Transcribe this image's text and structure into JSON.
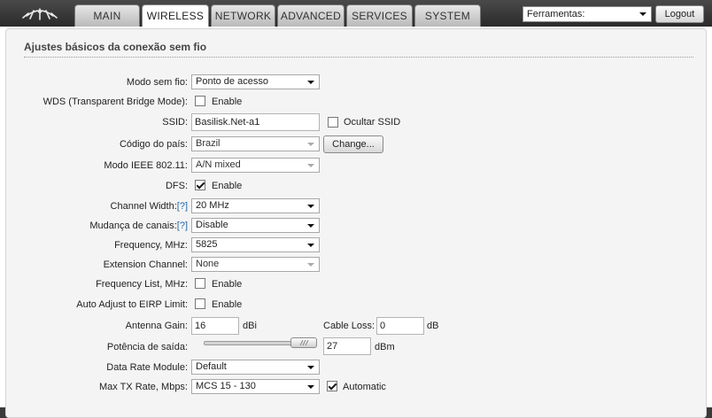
{
  "nav": {
    "tabs": [
      {
        "label": "MAIN",
        "active": false
      },
      {
        "label": "WIRELESS",
        "active": true
      },
      {
        "label": "NETWORK",
        "active": false
      },
      {
        "label": "ADVANCED",
        "active": false
      },
      {
        "label": "SERVICES",
        "active": false
      },
      {
        "label": "SYSTEM",
        "active": false
      }
    ],
    "tools_select": "Ferramentas:",
    "logout_label": "Logout"
  },
  "section": {
    "title": "Ajustes básicos da conexão sem fio"
  },
  "form": {
    "wireless_mode": {
      "label": "Modo sem fio:",
      "value": "Ponto de acesso"
    },
    "wds": {
      "label": "WDS (Transparent Bridge Mode):",
      "checkbox_label": "Enable",
      "checked": false
    },
    "ssid": {
      "label": "SSID:",
      "value": "Basilisk.Net-a1",
      "hide_label": "Ocultar SSID",
      "hide_checked": false
    },
    "country": {
      "label": "Código do país:",
      "value": "Brazil",
      "change_label": "Change..."
    },
    "ieee_mode": {
      "label": "Modo IEEE 802.11:",
      "value": "A/N mixed"
    },
    "dfs": {
      "label": "DFS:",
      "checkbox_label": "Enable",
      "checked": true
    },
    "channel_width": {
      "label": "Channel Width:",
      "help": "[?]",
      "value": "20 MHz"
    },
    "channel_shift": {
      "label": "Mudança de canais:",
      "help": "[?]",
      "value": "Disable"
    },
    "frequency": {
      "label": "Frequency, MHz:",
      "value": "5825"
    },
    "extension_channel": {
      "label": "Extension Channel:",
      "value": "None"
    },
    "frequency_list": {
      "label": "Frequency List, MHz:",
      "checkbox_label": "Enable",
      "checked": false
    },
    "auto_adjust": {
      "label": "Auto Adjust to EIRP Limit:",
      "checkbox_label": "Enable",
      "checked": false
    },
    "antenna_gain": {
      "label": "Antenna Gain:",
      "value": "16",
      "unit": "dBi"
    },
    "cable_loss": {
      "label": "Cable Loss:",
      "value": "0",
      "unit": "dB"
    },
    "output_power": {
      "label": "Potência de saída:",
      "value": "27",
      "unit": "dBm",
      "slider_fraction": 0.98
    },
    "data_rate_module": {
      "label": "Data Rate Module:",
      "value": "Default"
    },
    "max_tx_rate": {
      "label": "Max TX Rate, Mbps:",
      "value": "MCS 15 - 130",
      "auto_label": "Automatic",
      "auto_checked": true
    }
  },
  "colors": {
    "help_link": "#2266aa",
    "panel_bg": "#f4f4f4",
    "topbar": "#3a3a3a"
  }
}
